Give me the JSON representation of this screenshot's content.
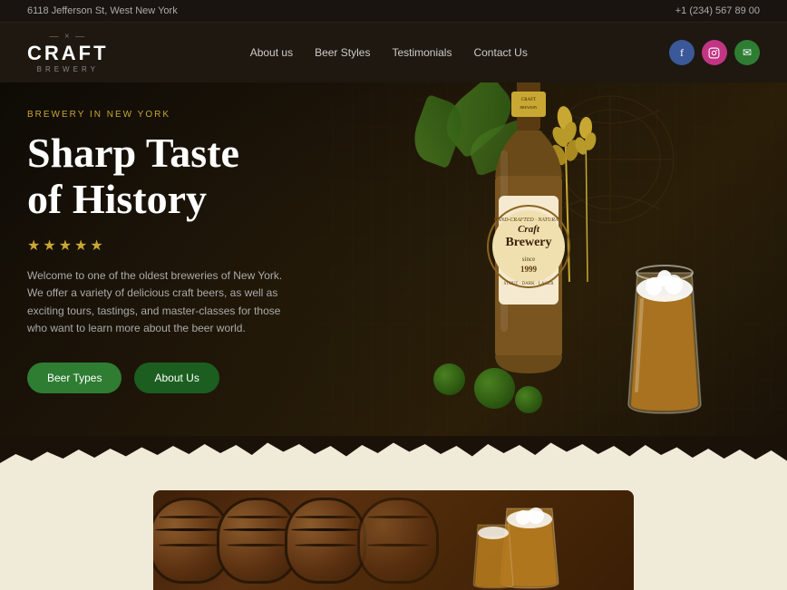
{
  "topbar": {
    "address": "6118 Jefferson St, West New York",
    "phone": "+1 (234) 567 89 00"
  },
  "header": {
    "logo": {
      "deco": "— × —",
      "title": "CRAFT",
      "subtitle": "BREWERY"
    },
    "nav": [
      {
        "label": "About us",
        "id": "about"
      },
      {
        "label": "Beer Styles",
        "id": "beer-styles"
      },
      {
        "label": "Testimonials",
        "id": "testimonials"
      },
      {
        "label": "Contact Us",
        "id": "contact"
      }
    ],
    "social": [
      {
        "icon": "f",
        "type": "facebook"
      },
      {
        "icon": "in",
        "type": "instagram"
      },
      {
        "icon": "✉",
        "type": "email"
      }
    ]
  },
  "hero": {
    "eyebrow": "BREWERY IN NEW YORK",
    "title_line1": "Sharp Taste",
    "title_line2": "of History",
    "stars": [
      "★",
      "★",
      "★",
      "★",
      "★"
    ],
    "description": "Welcome to one of the oldest breweries of New York. We offer a variety of delicious craft beers, as well as exciting tours, tastings, and master-classes for those who want to learn more about the beer world.",
    "btn_primary": "Beer Types",
    "btn_secondary": "About Us"
  },
  "colors": {
    "accent_gold": "#c8a832",
    "accent_green": "#2e7d32",
    "dark_bg": "#1a1208",
    "cream_bg": "#f0ead8"
  }
}
